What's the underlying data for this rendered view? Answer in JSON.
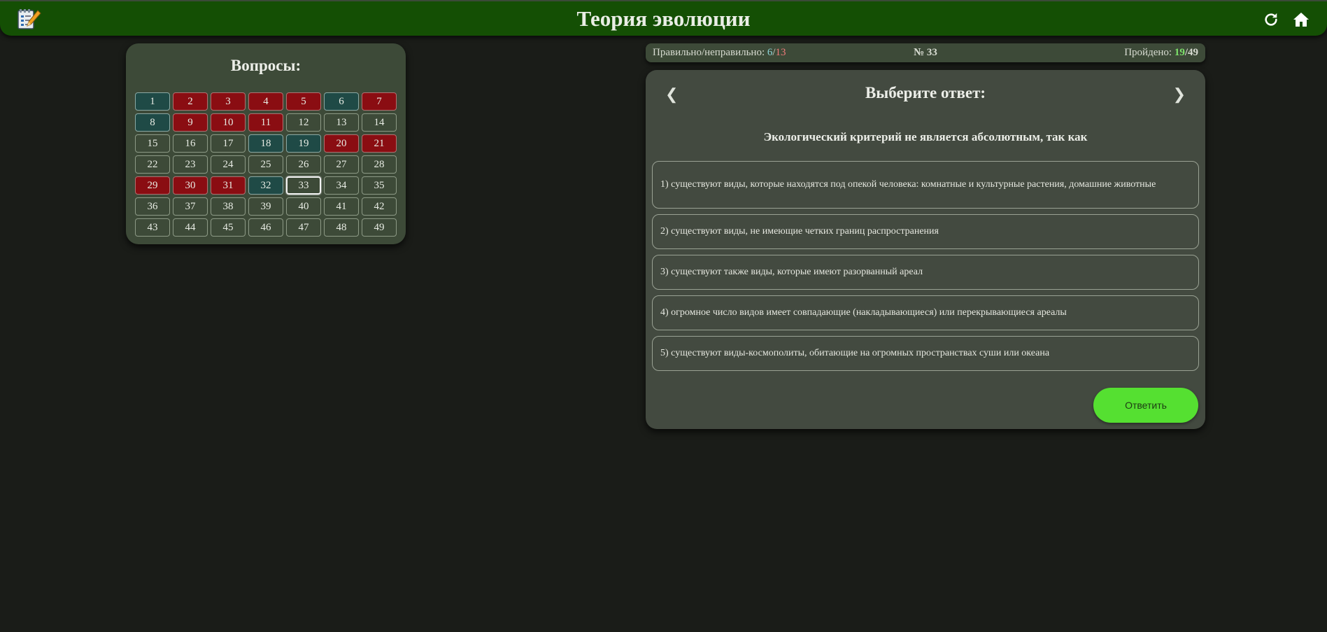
{
  "header": {
    "title": "Теория эволюции",
    "logo_icon": "notepad-pencil-icon",
    "refresh_icon": "refresh-icon",
    "home_icon": "home-icon"
  },
  "questions_panel": {
    "title": "Вопросы:",
    "items": [
      {
        "n": "1",
        "state": "correct"
      },
      {
        "n": "2",
        "state": "wrong"
      },
      {
        "n": "3",
        "state": "wrong"
      },
      {
        "n": "4",
        "state": "wrong"
      },
      {
        "n": "5",
        "state": "wrong"
      },
      {
        "n": "6",
        "state": "correct"
      },
      {
        "n": "7",
        "state": "wrong"
      },
      {
        "n": "8",
        "state": "correct"
      },
      {
        "n": "9",
        "state": "wrong"
      },
      {
        "n": "10",
        "state": "wrong"
      },
      {
        "n": "11",
        "state": "wrong"
      },
      {
        "n": "12",
        "state": "none"
      },
      {
        "n": "13",
        "state": "none"
      },
      {
        "n": "14",
        "state": "none"
      },
      {
        "n": "15",
        "state": "none"
      },
      {
        "n": "16",
        "state": "none"
      },
      {
        "n": "17",
        "state": "none"
      },
      {
        "n": "18",
        "state": "correct"
      },
      {
        "n": "19",
        "state": "correct"
      },
      {
        "n": "20",
        "state": "wrong"
      },
      {
        "n": "21",
        "state": "wrong"
      },
      {
        "n": "22",
        "state": "none"
      },
      {
        "n": "23",
        "state": "none"
      },
      {
        "n": "24",
        "state": "none"
      },
      {
        "n": "25",
        "state": "none"
      },
      {
        "n": "26",
        "state": "none"
      },
      {
        "n": "27",
        "state": "none"
      },
      {
        "n": "28",
        "state": "none"
      },
      {
        "n": "29",
        "state": "wrong"
      },
      {
        "n": "30",
        "state": "wrong"
      },
      {
        "n": "31",
        "state": "wrong"
      },
      {
        "n": "32",
        "state": "correct"
      },
      {
        "n": "33",
        "state": "current"
      },
      {
        "n": "34",
        "state": "none"
      },
      {
        "n": "35",
        "state": "none"
      },
      {
        "n": "36",
        "state": "none"
      },
      {
        "n": "37",
        "state": "none"
      },
      {
        "n": "38",
        "state": "none"
      },
      {
        "n": "39",
        "state": "none"
      },
      {
        "n": "40",
        "state": "none"
      },
      {
        "n": "41",
        "state": "none"
      },
      {
        "n": "42",
        "state": "none"
      },
      {
        "n": "43",
        "state": "none"
      },
      {
        "n": "44",
        "state": "none"
      },
      {
        "n": "45",
        "state": "none"
      },
      {
        "n": "46",
        "state": "none"
      },
      {
        "n": "47",
        "state": "none"
      },
      {
        "n": "48",
        "state": "none"
      },
      {
        "n": "49",
        "state": "none"
      }
    ]
  },
  "status": {
    "score_label": "Правильно/неправильно: ",
    "correct": "6",
    "separator": "/",
    "wrong": "13",
    "number_label": "№ 33",
    "passed_label": "Пройдено: ",
    "passed": "19",
    "total": "49"
  },
  "card": {
    "title": "Выберите ответ:",
    "prev_arrow": "❮",
    "next_arrow": "❯",
    "question": "Экологический критерий не является абсолютным, так как",
    "options": [
      "1) существуют виды, которые находятся под опекой человека: комнатные и культурные растения, домашние животные",
      "2) существуют виды, не имеющие четких границ распространения",
      "3) существуют также виды, которые имеют разорванный ареал",
      "4) огромное число видов имеет совпадающие (накладывающиеся) или перекрывающиеся ареалы",
      "5) существуют виды-космополиты, обитающие на огромных пространствах суши или океана"
    ],
    "submit_label": "Ответить"
  },
  "colors": {
    "header_bg": "#144f04",
    "correct_cell": "#1f4a46",
    "wrong_cell": "#8a0d12",
    "submit_button": "#55e031"
  }
}
